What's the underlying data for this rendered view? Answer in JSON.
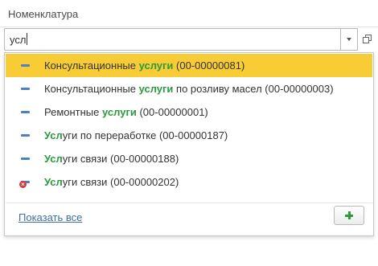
{
  "field": {
    "label": "Номенклатура",
    "input_value": "усл"
  },
  "dropdown": {
    "items": [
      {
        "before": "Консультационные ",
        "match": "услуги",
        "after": " (00-00000081)",
        "icon": "item-icon",
        "selected": true
      },
      {
        "before": "Консультационные ",
        "match": "услуги",
        "after": " по розливу масел (00-00000003)",
        "icon": "item-icon",
        "selected": false
      },
      {
        "before": "Ремонтные ",
        "match": "услуги",
        "after": " (00-00000001)",
        "icon": "item-icon",
        "selected": false
      },
      {
        "before": "",
        "match": "Усл",
        "after": "уги по переработке (00-00000187)",
        "icon": "item-icon",
        "selected": false
      },
      {
        "before": "",
        "match": "Усл",
        "after": "уги связи (00-00000188)",
        "icon": "item-icon",
        "selected": false
      },
      {
        "before": "",
        "match": "Усл",
        "after": "уги связи (00-00000202)",
        "icon": "deleted-item-icon",
        "selected": false
      }
    ],
    "show_all_label": "Показать все"
  },
  "colors": {
    "selected_bg": "#f7cc35",
    "highlight": "#2b9a3e",
    "link": "#3c6fa3",
    "item_icon": "#4c82c2",
    "delete_mark": "#d43a3a"
  }
}
